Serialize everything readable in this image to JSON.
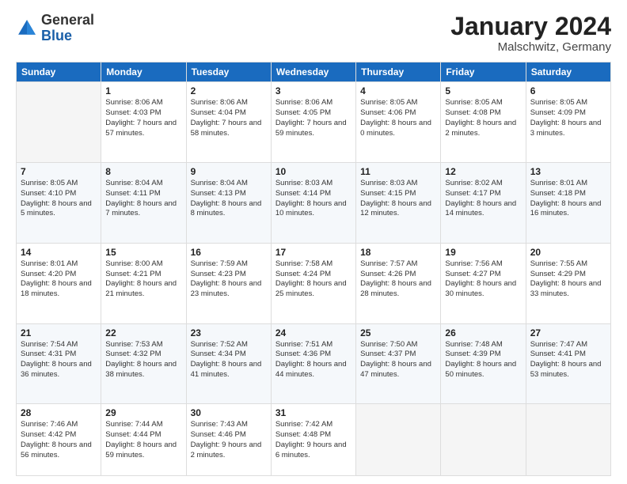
{
  "logo": {
    "general": "General",
    "blue": "Blue"
  },
  "title": {
    "month": "January 2024",
    "location": "Malschwitz, Germany"
  },
  "weekdays": [
    "Sunday",
    "Monday",
    "Tuesday",
    "Wednesday",
    "Thursday",
    "Friday",
    "Saturday"
  ],
  "rows": [
    [
      {
        "day": "",
        "empty": true
      },
      {
        "day": "1",
        "sunrise": "Sunrise: 8:06 AM",
        "sunset": "Sunset: 4:03 PM",
        "daylight": "Daylight: 7 hours and 57 minutes."
      },
      {
        "day": "2",
        "sunrise": "Sunrise: 8:06 AM",
        "sunset": "Sunset: 4:04 PM",
        "daylight": "Daylight: 7 hours and 58 minutes."
      },
      {
        "day": "3",
        "sunrise": "Sunrise: 8:06 AM",
        "sunset": "Sunset: 4:05 PM",
        "daylight": "Daylight: 7 hours and 59 minutes."
      },
      {
        "day": "4",
        "sunrise": "Sunrise: 8:05 AM",
        "sunset": "Sunset: 4:06 PM",
        "daylight": "Daylight: 8 hours and 0 minutes."
      },
      {
        "day": "5",
        "sunrise": "Sunrise: 8:05 AM",
        "sunset": "Sunset: 4:08 PM",
        "daylight": "Daylight: 8 hours and 2 minutes."
      },
      {
        "day": "6",
        "sunrise": "Sunrise: 8:05 AM",
        "sunset": "Sunset: 4:09 PM",
        "daylight": "Daylight: 8 hours and 3 minutes."
      }
    ],
    [
      {
        "day": "7",
        "sunrise": "Sunrise: 8:05 AM",
        "sunset": "Sunset: 4:10 PM",
        "daylight": "Daylight: 8 hours and 5 minutes."
      },
      {
        "day": "8",
        "sunrise": "Sunrise: 8:04 AM",
        "sunset": "Sunset: 4:11 PM",
        "daylight": "Daylight: 8 hours and 7 minutes."
      },
      {
        "day": "9",
        "sunrise": "Sunrise: 8:04 AM",
        "sunset": "Sunset: 4:13 PM",
        "daylight": "Daylight: 8 hours and 8 minutes."
      },
      {
        "day": "10",
        "sunrise": "Sunrise: 8:03 AM",
        "sunset": "Sunset: 4:14 PM",
        "daylight": "Daylight: 8 hours and 10 minutes."
      },
      {
        "day": "11",
        "sunrise": "Sunrise: 8:03 AM",
        "sunset": "Sunset: 4:15 PM",
        "daylight": "Daylight: 8 hours and 12 minutes."
      },
      {
        "day": "12",
        "sunrise": "Sunrise: 8:02 AM",
        "sunset": "Sunset: 4:17 PM",
        "daylight": "Daylight: 8 hours and 14 minutes."
      },
      {
        "day": "13",
        "sunrise": "Sunrise: 8:01 AM",
        "sunset": "Sunset: 4:18 PM",
        "daylight": "Daylight: 8 hours and 16 minutes."
      }
    ],
    [
      {
        "day": "14",
        "sunrise": "Sunrise: 8:01 AM",
        "sunset": "Sunset: 4:20 PM",
        "daylight": "Daylight: 8 hours and 18 minutes."
      },
      {
        "day": "15",
        "sunrise": "Sunrise: 8:00 AM",
        "sunset": "Sunset: 4:21 PM",
        "daylight": "Daylight: 8 hours and 21 minutes."
      },
      {
        "day": "16",
        "sunrise": "Sunrise: 7:59 AM",
        "sunset": "Sunset: 4:23 PM",
        "daylight": "Daylight: 8 hours and 23 minutes."
      },
      {
        "day": "17",
        "sunrise": "Sunrise: 7:58 AM",
        "sunset": "Sunset: 4:24 PM",
        "daylight": "Daylight: 8 hours and 25 minutes."
      },
      {
        "day": "18",
        "sunrise": "Sunrise: 7:57 AM",
        "sunset": "Sunset: 4:26 PM",
        "daylight": "Daylight: 8 hours and 28 minutes."
      },
      {
        "day": "19",
        "sunrise": "Sunrise: 7:56 AM",
        "sunset": "Sunset: 4:27 PM",
        "daylight": "Daylight: 8 hours and 30 minutes."
      },
      {
        "day": "20",
        "sunrise": "Sunrise: 7:55 AM",
        "sunset": "Sunset: 4:29 PM",
        "daylight": "Daylight: 8 hours and 33 minutes."
      }
    ],
    [
      {
        "day": "21",
        "sunrise": "Sunrise: 7:54 AM",
        "sunset": "Sunset: 4:31 PM",
        "daylight": "Daylight: 8 hours and 36 minutes."
      },
      {
        "day": "22",
        "sunrise": "Sunrise: 7:53 AM",
        "sunset": "Sunset: 4:32 PM",
        "daylight": "Daylight: 8 hours and 38 minutes."
      },
      {
        "day": "23",
        "sunrise": "Sunrise: 7:52 AM",
        "sunset": "Sunset: 4:34 PM",
        "daylight": "Daylight: 8 hours and 41 minutes."
      },
      {
        "day": "24",
        "sunrise": "Sunrise: 7:51 AM",
        "sunset": "Sunset: 4:36 PM",
        "daylight": "Daylight: 8 hours and 44 minutes."
      },
      {
        "day": "25",
        "sunrise": "Sunrise: 7:50 AM",
        "sunset": "Sunset: 4:37 PM",
        "daylight": "Daylight: 8 hours and 47 minutes."
      },
      {
        "day": "26",
        "sunrise": "Sunrise: 7:48 AM",
        "sunset": "Sunset: 4:39 PM",
        "daylight": "Daylight: 8 hours and 50 minutes."
      },
      {
        "day": "27",
        "sunrise": "Sunrise: 7:47 AM",
        "sunset": "Sunset: 4:41 PM",
        "daylight": "Daylight: 8 hours and 53 minutes."
      }
    ],
    [
      {
        "day": "28",
        "sunrise": "Sunrise: 7:46 AM",
        "sunset": "Sunset: 4:42 PM",
        "daylight": "Daylight: 8 hours and 56 minutes."
      },
      {
        "day": "29",
        "sunrise": "Sunrise: 7:44 AM",
        "sunset": "Sunset: 4:44 PM",
        "daylight": "Daylight: 8 hours and 59 minutes."
      },
      {
        "day": "30",
        "sunrise": "Sunrise: 7:43 AM",
        "sunset": "Sunset: 4:46 PM",
        "daylight": "Daylight: 9 hours and 2 minutes."
      },
      {
        "day": "31",
        "sunrise": "Sunrise: 7:42 AM",
        "sunset": "Sunset: 4:48 PM",
        "daylight": "Daylight: 9 hours and 6 minutes."
      },
      {
        "day": "",
        "empty": true
      },
      {
        "day": "",
        "empty": true
      },
      {
        "day": "",
        "empty": true
      }
    ]
  ]
}
